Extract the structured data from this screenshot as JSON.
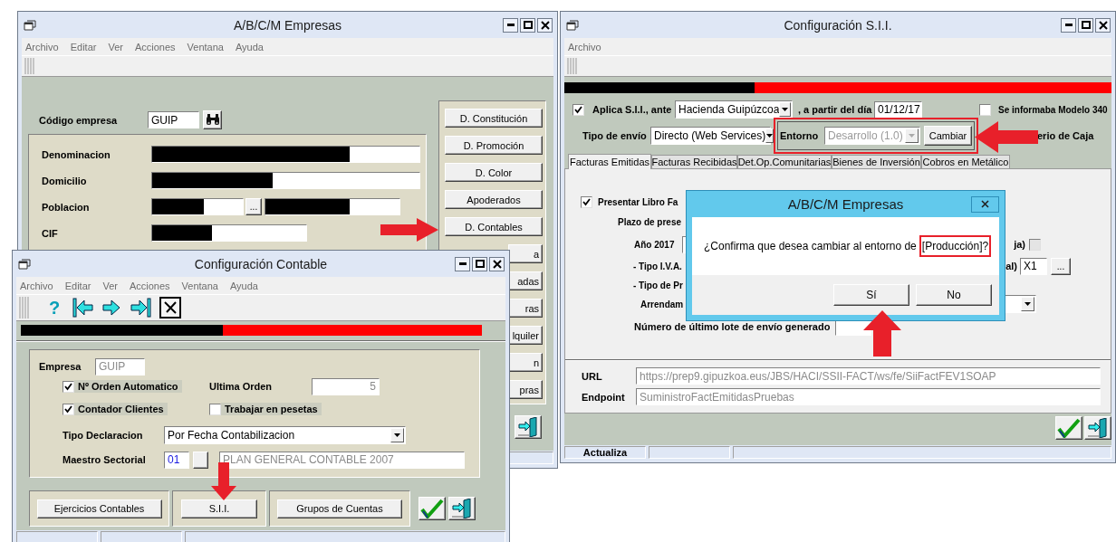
{
  "empresas_window": {
    "title": "A/B/C/M Empresas",
    "menu": [
      "Archivo",
      "Editar",
      "Ver",
      "Acciones",
      "Ventana",
      "Ayuda"
    ],
    "codigo": {
      "label": "Código empresa",
      "value": "GUIP"
    },
    "fields": [
      {
        "label": "Denominacion",
        "redacted": true
      },
      {
        "label": "Domicilio",
        "redacted": true
      },
      {
        "label": "Poblacion",
        "redacted": true,
        "lookup": "..."
      },
      {
        "label": "CIF",
        "redacted": true
      }
    ],
    "side_buttons": [
      "D. Constitución",
      "D. Promoción",
      "D. Color",
      "Apoderados",
      "D. Contables",
      "a",
      "adas",
      "ras",
      "lquiler",
      "n",
      "pras"
    ]
  },
  "contable_window": {
    "title": "Configuración Contable",
    "menu": [
      "Archivo",
      "Editar",
      "Ver",
      "Acciones",
      "Ventana",
      "Ayuda"
    ],
    "help": "?",
    "empresa": {
      "label": "Empresa",
      "value": "GUIP",
      "disabled": true
    },
    "checks": [
      {
        "label": "Nº Orden Automatico",
        "checked": true
      },
      {
        "label": "Contador Clientes",
        "checked": true
      },
      {
        "label": "Trabajar en pesetas",
        "checked": false
      }
    ],
    "ultima_orden": {
      "label": "Ultima Orden",
      "value": "5",
      "disabled": true
    },
    "tipo_declaracion": {
      "label": "Tipo Declaracion",
      "value": "Por Fecha Contabilizacion"
    },
    "maestro_sectorial": {
      "label": "Maestro Sectorial",
      "code": "01",
      "name": "PLAN GENERAL CONTABLE 2007",
      "disabled": true
    },
    "buttons": [
      "Ejercicios Contables",
      "S.I.I.",
      "Grupos de Cuentas"
    ]
  },
  "sii_window": {
    "title": "Configuración S.I.I.",
    "menu": [
      "Archivo"
    ],
    "aplica": {
      "label": "Aplica S.I.I., ante",
      "checked": true,
      "value": "Hacienda Guipúzcoa"
    },
    "fecha": {
      "label": ", a partir del día",
      "value": "01/12/17"
    },
    "modelo_340": {
      "label": "Se informaba Modelo 340",
      "checked": false
    },
    "tipo_envio": {
      "label": "Tipo de envío",
      "value": "Directo (Web Services)"
    },
    "entorno": {
      "label": "Entorno",
      "value": "Desarrollo (1.0)",
      "disabled": true,
      "button": "Cambiar"
    },
    "criterio_caja": "erio de Caja",
    "tabs": [
      {
        "label": "Facturas Emitidas",
        "selected": true
      },
      {
        "label": "Facturas Recibidas",
        "selected": false
      },
      {
        "label": "Det.Op.Comunitarias",
        "selected": false
      },
      {
        "label": "Bienes de Inversión",
        "selected": false
      },
      {
        "label": "Cobros en Metálico",
        "selected": false
      }
    ],
    "presentar": {
      "label": "Presentar Libro Fa",
      "checked": true
    },
    "plazo": "Plazo de prese",
    "ano": {
      "label": "Año 2017",
      "right_label": "ja)",
      "checked": false
    },
    "tipo_iva": {
      "label": "- Tipo I.V.A.",
      "right_label": "al)",
      "value": "X1",
      "button": "..."
    },
    "tipo_pr": "- Tipo de Pr",
    "arrendam": "Arrendam",
    "lote": "Número de último lote de envío generado",
    "url": {
      "label": "URL",
      "value": "https://prep9.gipuzkoa.eus/JBS/HACI/SSII-FACT/ws/fe/SiiFactFEV1SOAP",
      "disabled": true
    },
    "endpoint": {
      "label": "Endpoint",
      "value": "SuministroFactEmitidasPruebas",
      "disabled": true
    },
    "status": "Actualiza"
  },
  "confirm_dialog": {
    "title": "A/B/C/M Empresas",
    "message": "¿Confirma que desea cambiar al entorno de",
    "highlight": "[Producción]?",
    "buttons": [
      "Sí",
      "No"
    ]
  }
}
